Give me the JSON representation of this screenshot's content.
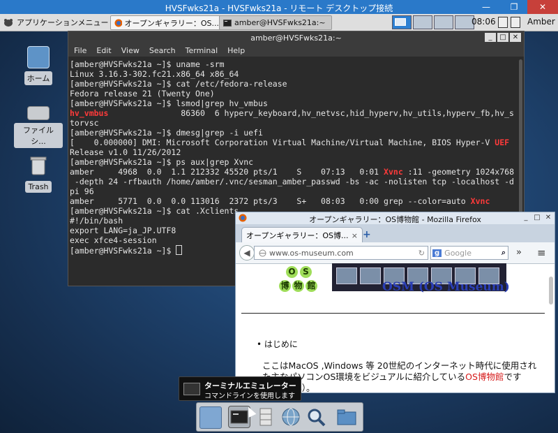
{
  "rdp": {
    "title": "HVSFwks21a - HVSFwks21a - リモート デスクトップ接続",
    "minimize": "—",
    "restore": "❐",
    "close": "✕"
  },
  "panel": {
    "app_menu": "アプリケーションメニュー",
    "tasks": [
      {
        "label": "オープンギャラリー：OS..."
      },
      {
        "label": "amber@HVSFwks21a:~"
      }
    ],
    "clock": "08:06",
    "user": "Amber"
  },
  "desktop_icons": [
    {
      "label": "ホーム"
    },
    {
      "label": "ファイルシ..."
    },
    {
      "label": "Trash"
    }
  ],
  "terminal": {
    "title": "amber@HVSFwks21a:~",
    "menu": [
      "File",
      "Edit",
      "View",
      "Search",
      "Terminal",
      "Help"
    ],
    "lines": [
      "[amber@HVSFwks21a ~]$ uname -srm",
      "Linux 3.16.3-302.fc21.x86_64 x86_64",
      "[amber@HVSFwks21a ~]$ cat /etc/fedora-release",
      "Fedora release 21 (Twenty One)",
      "[amber@HVSFwks21a ~]$ lsmod|grep hv_vmbus"
    ],
    "lsmod_hit": "hv_vmbus",
    "lsmod_rest": "               86360  6 hyperv_keyboard,hv_netvsc,hid_hyperv,hv_utils,hyperv_fb,hv_s",
    "lsmod_wrap": "torvsc",
    "dmesg_cmd": "[amber@HVSFwks21a ~]$ dmesg|grep -i uefi",
    "dmesg_pre": "[    0.000000] DMI: Microsoft Corporation Virtual Machine/Virtual Machine, BIOS Hyper-V ",
    "dmesg_hit": "UEF",
    "dmesg_wrap": "Release v1.0 11/26/2012",
    "ps_cmd": "[amber@HVSFwks21a ~]$ ps aux|grep Xvnc",
    "ps1_pre": "amber     4968  0.0  1.1 212332 45520 pts/1    S    07:13   0:01 ",
    "ps1_hit": "Xvnc",
    "ps1_post": " :11 -geometry 1024x768",
    "ps1_wrap1": " -depth 24 -rfbauth /home/amber/.vnc/sesman_amber_passwd -bs -ac -nolisten tcp -localhost -d",
    "ps1_wrap2": "pi 96",
    "ps2_pre": "amber     5771  0.0  0.0 113016  2372 pts/3    S+   08:03   0:00 grep --color=auto ",
    "ps2_hit": "Xvnc",
    "tail": [
      "[amber@HVSFwks21a ~]$ cat .Xclients",
      "#!/bin/bash",
      "export LANG=ja_JP.UTF8",
      "exec xfce4-session"
    ],
    "prompt": "[amber@HVSFwks21a ~]$ "
  },
  "firefox": {
    "title": "オープンギャラリー：OS博物館 - Mozilla Firefox",
    "tab_label": "オープンギャラリー：OS博...",
    "url": "www.os-museum.com",
    "search_engine": "g",
    "search_placeholder": "Google",
    "logo_chars": [
      "O",
      "S",
      "博",
      "物",
      "館"
    ],
    "site_title": "OSM (OS Museum)",
    "bullet": "はじめに",
    "para_pre": "ここはMacOS ,Windows 等 20世紀のインターネット時代に使用された主なパソコンOS環境をビジュアルに紹介している",
    "para_link": "OS博物館",
    "para_post": "です（1994年）。"
  },
  "tooltip": {
    "title": "ターミナルエミュレーター",
    "subtitle": "コマンドラインを使用します"
  },
  "colors": {
    "highlight": "#ff3a3a",
    "rdp_bar": "#2a79c9",
    "link": "#d61a1a"
  }
}
